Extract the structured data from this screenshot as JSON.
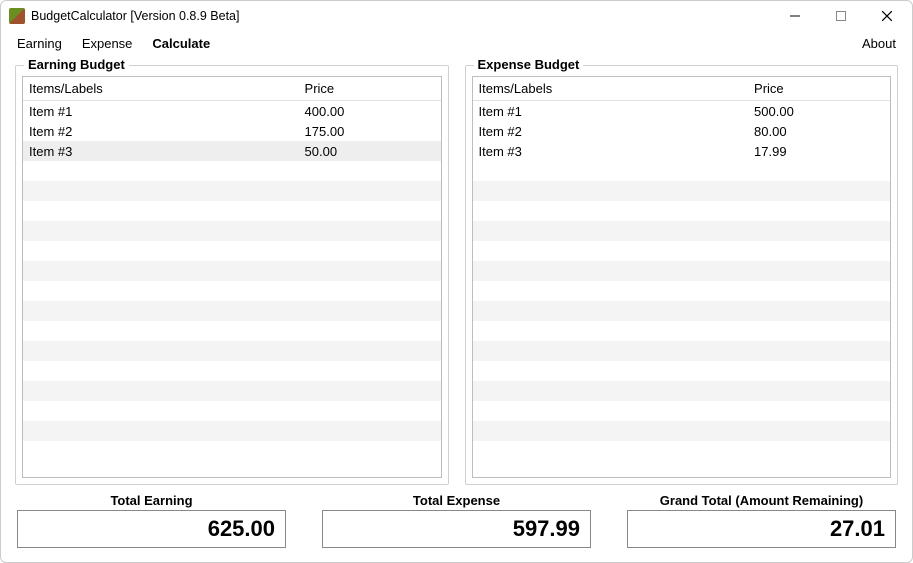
{
  "window": {
    "title": "BudgetCalculator [Version 0.8.9 Beta]"
  },
  "menu": {
    "earning": "Earning",
    "expense": "Expense",
    "calculate": "Calculate",
    "about": "About"
  },
  "panels": {
    "earning": {
      "title": "Earning Budget",
      "columns": {
        "label": "Items/Labels",
        "price": "Price"
      },
      "rows": [
        {
          "label": "Item #1",
          "price": "400.00"
        },
        {
          "label": "Item #2",
          "price": "175.00"
        },
        {
          "label": "Item #3",
          "price": "50.00"
        }
      ]
    },
    "expense": {
      "title": "Expense Budget",
      "columns": {
        "label": "Items/Labels",
        "price": "Price"
      },
      "rows": [
        {
          "label": "Item #1",
          "price": "500.00"
        },
        {
          "label": "Item #2",
          "price": "80.00"
        },
        {
          "label": "Item #3",
          "price": "17.99"
        }
      ]
    }
  },
  "totals": {
    "earning": {
      "caption": "Total Earning",
      "value": "625.00"
    },
    "expense": {
      "caption": "Total Expense",
      "value": "597.99"
    },
    "grand": {
      "caption": "Grand Total (Amount Remaining)",
      "value": "27.01"
    }
  }
}
